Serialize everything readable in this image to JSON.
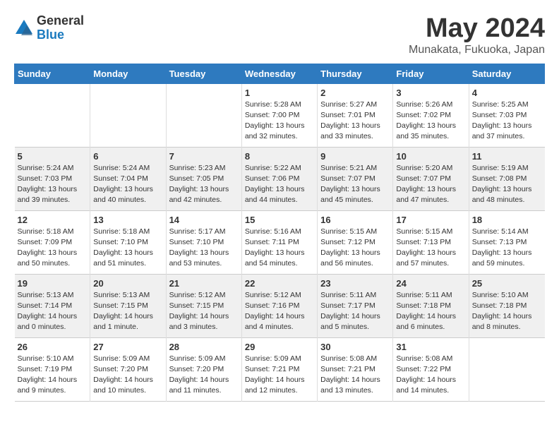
{
  "header": {
    "logo_general": "General",
    "logo_blue": "Blue",
    "title": "May 2024",
    "subtitle": "Munakata, Fukuoka, Japan"
  },
  "weekdays": [
    "Sunday",
    "Monday",
    "Tuesday",
    "Wednesday",
    "Thursday",
    "Friday",
    "Saturday"
  ],
  "weeks": [
    [
      {
        "day": "",
        "info": ""
      },
      {
        "day": "",
        "info": ""
      },
      {
        "day": "",
        "info": ""
      },
      {
        "day": "1",
        "info": "Sunrise: 5:28 AM\nSunset: 7:00 PM\nDaylight: 13 hours\nand 32 minutes."
      },
      {
        "day": "2",
        "info": "Sunrise: 5:27 AM\nSunset: 7:01 PM\nDaylight: 13 hours\nand 33 minutes."
      },
      {
        "day": "3",
        "info": "Sunrise: 5:26 AM\nSunset: 7:02 PM\nDaylight: 13 hours\nand 35 minutes."
      },
      {
        "day": "4",
        "info": "Sunrise: 5:25 AM\nSunset: 7:03 PM\nDaylight: 13 hours\nand 37 minutes."
      }
    ],
    [
      {
        "day": "5",
        "info": "Sunrise: 5:24 AM\nSunset: 7:03 PM\nDaylight: 13 hours\nand 39 minutes."
      },
      {
        "day": "6",
        "info": "Sunrise: 5:24 AM\nSunset: 7:04 PM\nDaylight: 13 hours\nand 40 minutes."
      },
      {
        "day": "7",
        "info": "Sunrise: 5:23 AM\nSunset: 7:05 PM\nDaylight: 13 hours\nand 42 minutes."
      },
      {
        "day": "8",
        "info": "Sunrise: 5:22 AM\nSunset: 7:06 PM\nDaylight: 13 hours\nand 44 minutes."
      },
      {
        "day": "9",
        "info": "Sunrise: 5:21 AM\nSunset: 7:07 PM\nDaylight: 13 hours\nand 45 minutes."
      },
      {
        "day": "10",
        "info": "Sunrise: 5:20 AM\nSunset: 7:07 PM\nDaylight: 13 hours\nand 47 minutes."
      },
      {
        "day": "11",
        "info": "Sunrise: 5:19 AM\nSunset: 7:08 PM\nDaylight: 13 hours\nand 48 minutes."
      }
    ],
    [
      {
        "day": "12",
        "info": "Sunrise: 5:18 AM\nSunset: 7:09 PM\nDaylight: 13 hours\nand 50 minutes."
      },
      {
        "day": "13",
        "info": "Sunrise: 5:18 AM\nSunset: 7:10 PM\nDaylight: 13 hours\nand 51 minutes."
      },
      {
        "day": "14",
        "info": "Sunrise: 5:17 AM\nSunset: 7:10 PM\nDaylight: 13 hours\nand 53 minutes."
      },
      {
        "day": "15",
        "info": "Sunrise: 5:16 AM\nSunset: 7:11 PM\nDaylight: 13 hours\nand 54 minutes."
      },
      {
        "day": "16",
        "info": "Sunrise: 5:15 AM\nSunset: 7:12 PM\nDaylight: 13 hours\nand 56 minutes."
      },
      {
        "day": "17",
        "info": "Sunrise: 5:15 AM\nSunset: 7:13 PM\nDaylight: 13 hours\nand 57 minutes."
      },
      {
        "day": "18",
        "info": "Sunrise: 5:14 AM\nSunset: 7:13 PM\nDaylight: 13 hours\nand 59 minutes."
      }
    ],
    [
      {
        "day": "19",
        "info": "Sunrise: 5:13 AM\nSunset: 7:14 PM\nDaylight: 14 hours\nand 0 minutes."
      },
      {
        "day": "20",
        "info": "Sunrise: 5:13 AM\nSunset: 7:15 PM\nDaylight: 14 hours\nand 1 minute."
      },
      {
        "day": "21",
        "info": "Sunrise: 5:12 AM\nSunset: 7:15 PM\nDaylight: 14 hours\nand 3 minutes."
      },
      {
        "day": "22",
        "info": "Sunrise: 5:12 AM\nSunset: 7:16 PM\nDaylight: 14 hours\nand 4 minutes."
      },
      {
        "day": "23",
        "info": "Sunrise: 5:11 AM\nSunset: 7:17 PM\nDaylight: 14 hours\nand 5 minutes."
      },
      {
        "day": "24",
        "info": "Sunrise: 5:11 AM\nSunset: 7:18 PM\nDaylight: 14 hours\nand 6 minutes."
      },
      {
        "day": "25",
        "info": "Sunrise: 5:10 AM\nSunset: 7:18 PM\nDaylight: 14 hours\nand 8 minutes."
      }
    ],
    [
      {
        "day": "26",
        "info": "Sunrise: 5:10 AM\nSunset: 7:19 PM\nDaylight: 14 hours\nand 9 minutes."
      },
      {
        "day": "27",
        "info": "Sunrise: 5:09 AM\nSunset: 7:20 PM\nDaylight: 14 hours\nand 10 minutes."
      },
      {
        "day": "28",
        "info": "Sunrise: 5:09 AM\nSunset: 7:20 PM\nDaylight: 14 hours\nand 11 minutes."
      },
      {
        "day": "29",
        "info": "Sunrise: 5:09 AM\nSunset: 7:21 PM\nDaylight: 14 hours\nand 12 minutes."
      },
      {
        "day": "30",
        "info": "Sunrise: 5:08 AM\nSunset: 7:21 PM\nDaylight: 14 hours\nand 13 minutes."
      },
      {
        "day": "31",
        "info": "Sunrise: 5:08 AM\nSunset: 7:22 PM\nDaylight: 14 hours\nand 14 minutes."
      },
      {
        "day": "",
        "info": ""
      }
    ]
  ]
}
